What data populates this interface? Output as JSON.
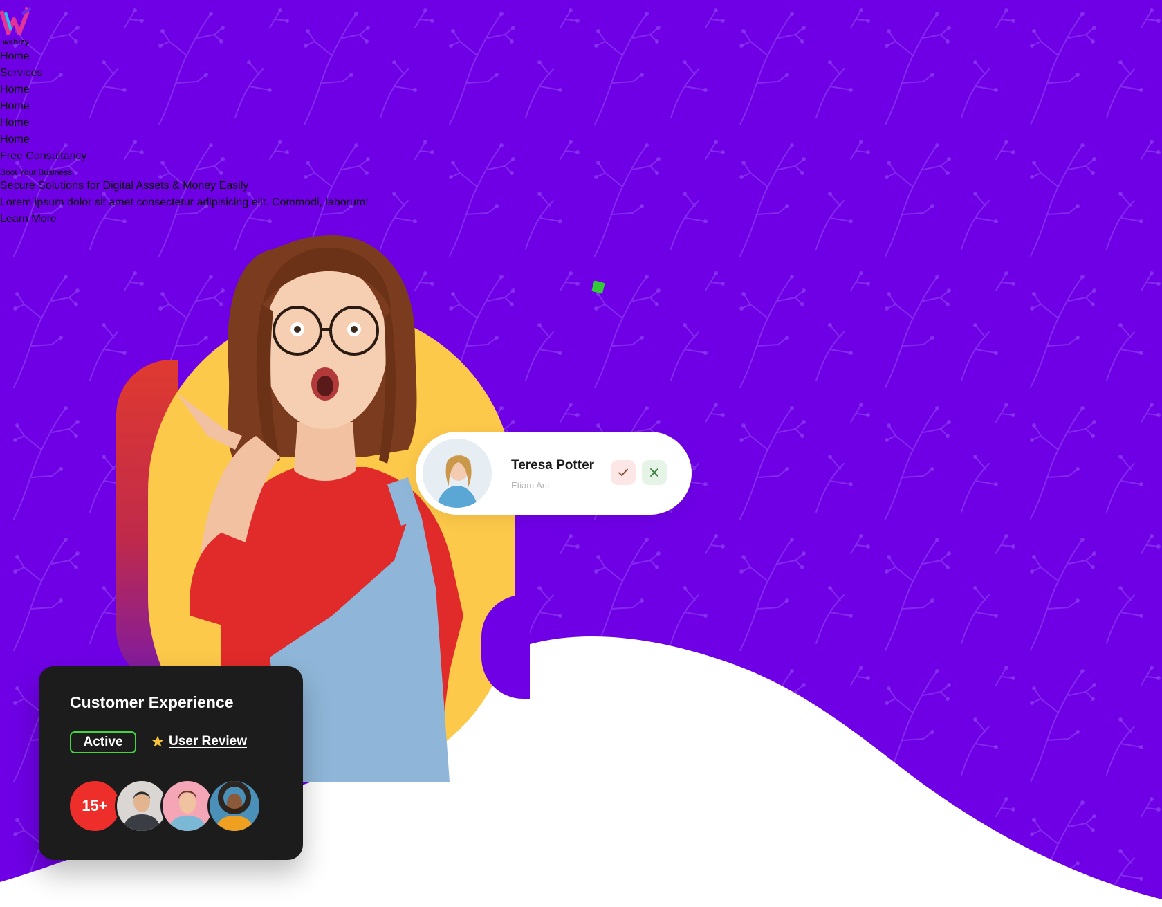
{
  "brand": {
    "logo_text": "webizy"
  },
  "nav": {
    "items": [
      "Home",
      "Services",
      "Home",
      "Home",
      "Home",
      "Home",
      "Free Consultancy"
    ]
  },
  "hero": {
    "tag": "Boot Your Business",
    "title": "Secure Solutions for Digital Assets & Money Easily",
    "description": "Lorem ipsum dolor sit amet consectetur adipisicing elit. Commodi, laborum!",
    "cta": "Learn More"
  },
  "profile_card": {
    "name": "Teresa Potter",
    "subtitle": "Etiam Ant",
    "accept_icon": "check-icon",
    "reject_icon": "close-icon"
  },
  "experience_card": {
    "title": "Customer Experience",
    "status": "Active",
    "review_label": "User Review",
    "count": "15+"
  },
  "colors": {
    "background": "#6f00e6",
    "accent_yellow": "#fdc94a",
    "active_green": "#42d642",
    "count_red": "#ee2e2a"
  }
}
